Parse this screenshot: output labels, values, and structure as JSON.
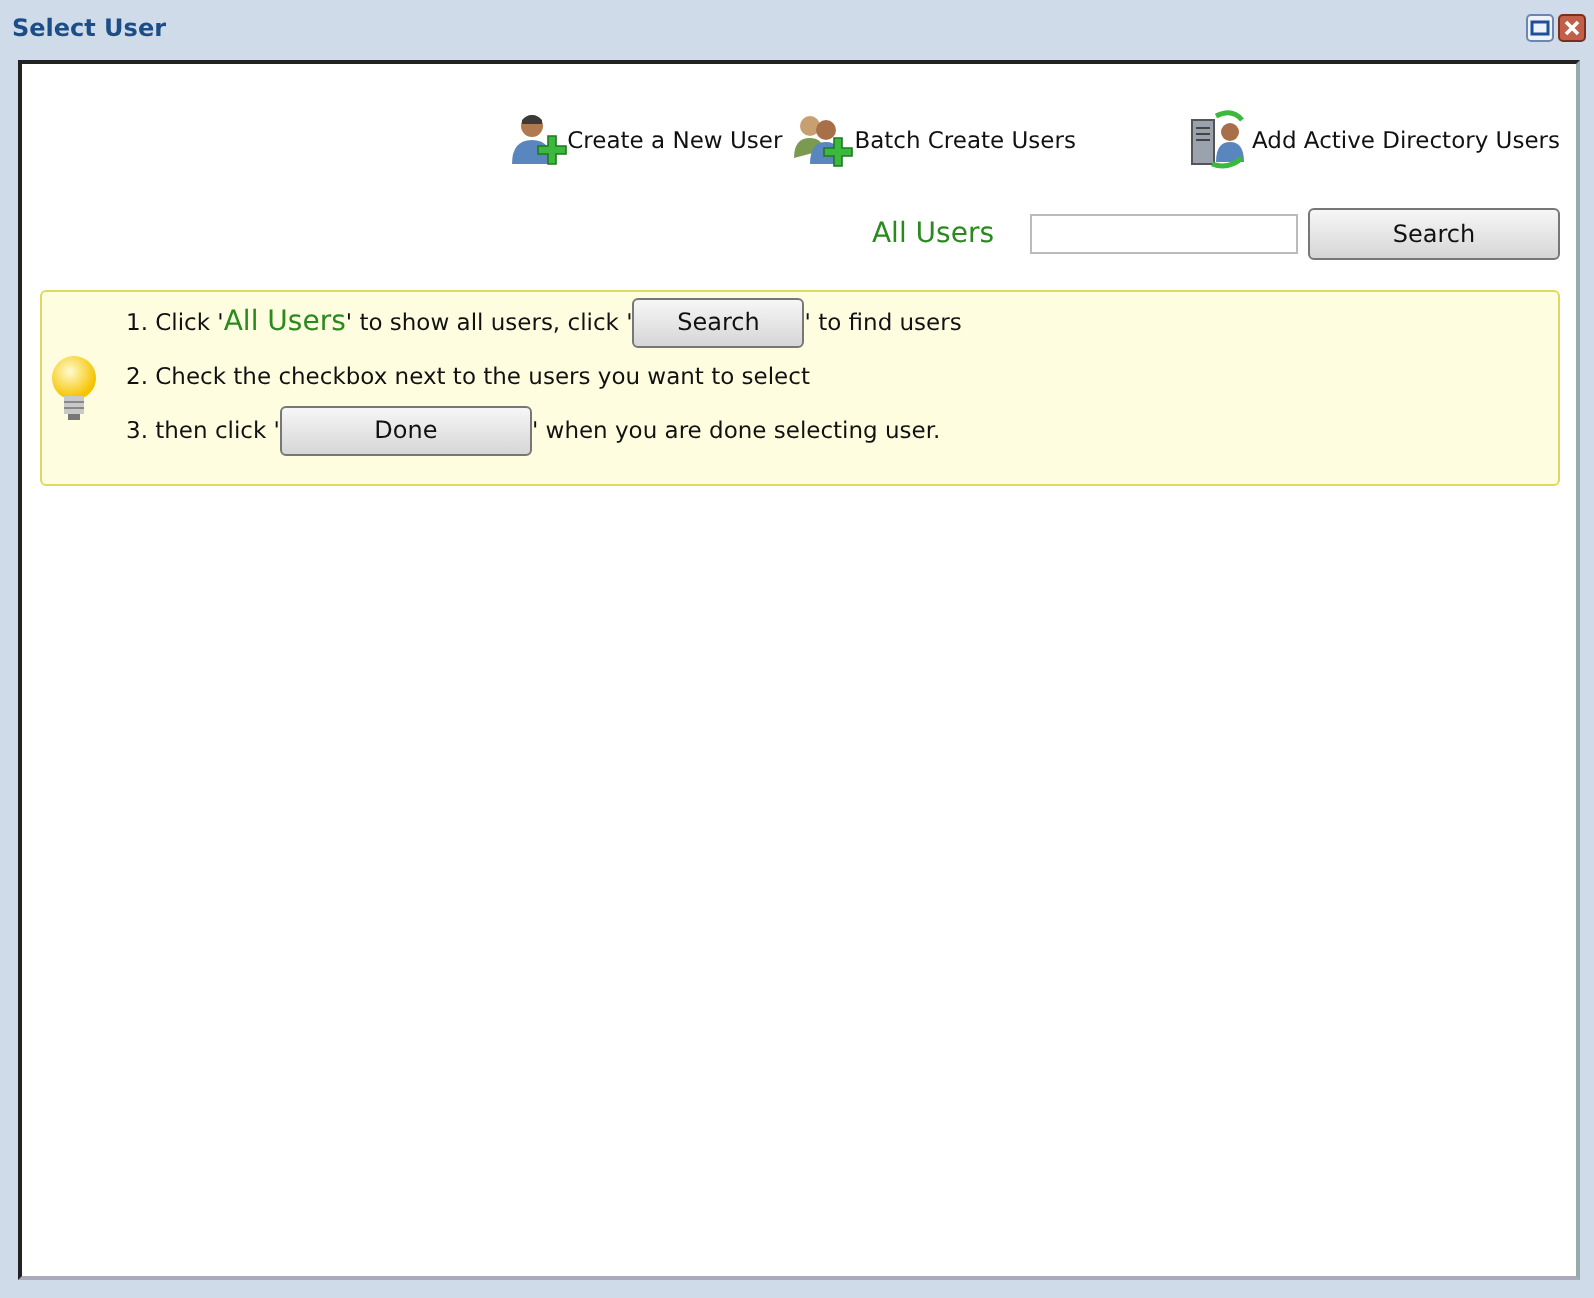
{
  "window": {
    "title": "Select User"
  },
  "actions": [
    {
      "kind": "create",
      "label": "Create a New User"
    },
    {
      "kind": "batch",
      "label": "Batch Create Users"
    },
    {
      "kind": "directory",
      "label": "Add Active Directory Users"
    }
  ],
  "search_bar": {
    "all_users_link": "All Users",
    "button": "Search"
  },
  "instructions": [
    [
      {
        "kind": "text",
        "text": "1. Click '"
      },
      {
        "kind": "link",
        "text": "All Users"
      },
      {
        "kind": "text",
        "text": "' to show all users, click '"
      },
      {
        "kind": "button",
        "text": "Search"
      },
      {
        "kind": "text",
        "text": "' to find users"
      }
    ],
    [
      {
        "kind": "text",
        "text": "2. Check the checkbox next to the users you want to select"
      }
    ],
    [
      {
        "kind": "text",
        "text": "3. then click '"
      },
      {
        "kind": "button",
        "text": "Done"
      },
      {
        "kind": "text",
        "text": "' when you are done selecting user."
      }
    ]
  ]
}
